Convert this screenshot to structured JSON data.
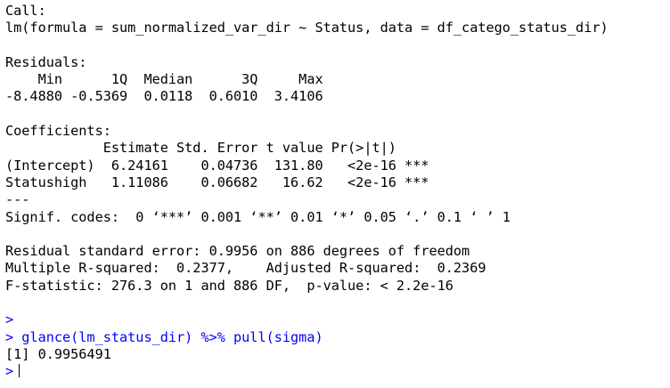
{
  "console": {
    "call_header": "Call:",
    "call_formula": "lm(formula = sum_normalized_var_dir ~ Status, data = df_catego_status_dir)",
    "blank1": "",
    "residuals_header": "Residuals:",
    "residuals_cols": "    Min      1Q  Median      3Q     Max ",
    "residuals_vals": "-8.4880 -0.5369  0.0118  0.6010  3.4106 ",
    "blank2": "",
    "coef_header": "Coefficients:",
    "coef_cols": "            Estimate Std. Error t value Pr(>|t|)    ",
    "coef_row1": "(Intercept)  6.24161    0.04736  131.80   <2e-16 ***",
    "coef_row2": "Statushigh   1.11086    0.06682   16.62   <2e-16 ***",
    "coef_sep": "---",
    "signif": "Signif. codes:  0 ‘***’ 0.001 ‘**’ 0.01 ‘*’ 0.05 ‘.’ 0.1 ‘ ’ 1",
    "blank3": "",
    "rse": "Residual standard error: 0.9956 on 886 degrees of freedom",
    "r2": "Multiple R-squared:  0.2377,\tAdjusted R-squared:  0.2369 ",
    "fstat": "F-statistic: 276.3 on 1 and 886 DF,  p-value: < 2.2e-16",
    "blank4": "",
    "prompt_empty": ">",
    "prompt_cmd": "> glance(lm_status_dir) %>% pull(sigma)",
    "output": "[1] 0.9956491",
    "prompt_current": ">"
  },
  "colors": {
    "text": "#000000",
    "prompt": "#0000ff",
    "background": "#ffffff"
  }
}
